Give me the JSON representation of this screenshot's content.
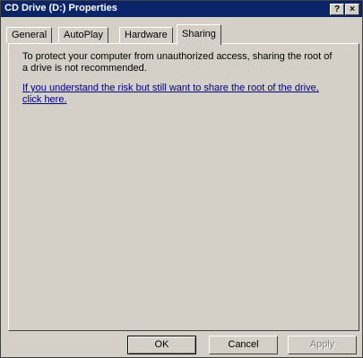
{
  "window": {
    "title": "CD Drive (D:) Properties",
    "help_label": "?",
    "close_label": "×"
  },
  "tabs": [
    {
      "label": "General"
    },
    {
      "label": "AutoPlay"
    },
    {
      "label": "Hardware"
    },
    {
      "label": "Sharing",
      "active": true
    }
  ],
  "sharing": {
    "message": "To protect your computer from unauthorized access, sharing the root of a drive is not recommended.",
    "link": "If you understand the risk but still want to share the root of the drive, click here."
  },
  "buttons": {
    "ok": "OK",
    "cancel": "Cancel",
    "apply": "Apply"
  },
  "colors": {
    "titlebar": "#0a246a",
    "dialog_face": "#d4d0c8",
    "link": "#000080"
  }
}
